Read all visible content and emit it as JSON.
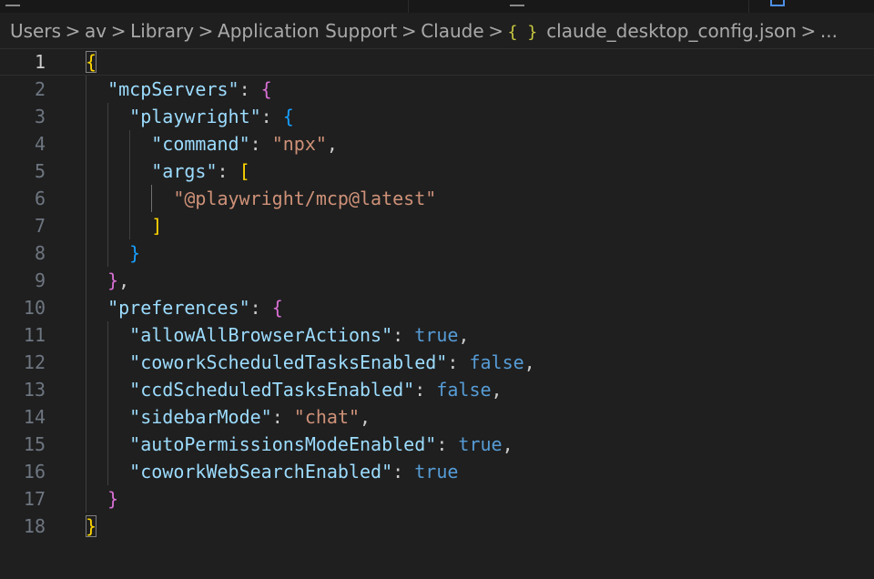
{
  "breadcrumb": [
    {
      "label": "Users"
    },
    {
      "label": "av"
    },
    {
      "label": "Library"
    },
    {
      "label": "Application Support"
    },
    {
      "label": "Claude"
    },
    {
      "label": "claude_desktop_config.json",
      "icon": "json-file-icon",
      "icon_glyph": "{ }"
    },
    {
      "label": "..."
    }
  ],
  "breadcrumb_separator": ">",
  "editor": {
    "current_line": 1,
    "syntax_colors": {
      "key": "#9cdcfe",
      "string": "#ce9178",
      "keyword": "#569cd6",
      "bracket_level_1": "#ffd700",
      "bracket_level_2": "#da70d6",
      "bracket_level_3": "#179fff"
    },
    "lines": [
      {
        "num": "1",
        "indent": 0,
        "tokens": [
          {
            "t": "{",
            "c": "b1"
          }
        ]
      },
      {
        "num": "2",
        "indent": 1,
        "tokens": [
          {
            "t": "\"mcpServers\"",
            "c": "key"
          },
          {
            "t": ": ",
            "c": "p"
          },
          {
            "t": "{",
            "c": "b2"
          }
        ]
      },
      {
        "num": "3",
        "indent": 2,
        "tokens": [
          {
            "t": "\"playwright\"",
            "c": "key"
          },
          {
            "t": ": ",
            "c": "p"
          },
          {
            "t": "{",
            "c": "b3"
          }
        ]
      },
      {
        "num": "4",
        "indent": 3,
        "tokens": [
          {
            "t": "\"command\"",
            "c": "key"
          },
          {
            "t": ": ",
            "c": "p"
          },
          {
            "t": "\"npx\"",
            "c": "str"
          },
          {
            "t": ",",
            "c": "p"
          }
        ]
      },
      {
        "num": "5",
        "indent": 3,
        "tokens": [
          {
            "t": "\"args\"",
            "c": "key"
          },
          {
            "t": ": ",
            "c": "p"
          },
          {
            "t": "[",
            "c": "b1"
          }
        ]
      },
      {
        "num": "6",
        "indent": 4,
        "tokens": [
          {
            "t": "\"@playwright/mcp@latest\"",
            "c": "str"
          }
        ]
      },
      {
        "num": "7",
        "indent": 3,
        "tokens": [
          {
            "t": "]",
            "c": "b1"
          }
        ]
      },
      {
        "num": "8",
        "indent": 2,
        "tokens": [
          {
            "t": "}",
            "c": "b3"
          }
        ]
      },
      {
        "num": "9",
        "indent": 1,
        "tokens": [
          {
            "t": "}",
            "c": "b2"
          },
          {
            "t": ",",
            "c": "p"
          }
        ]
      },
      {
        "num": "10",
        "indent": 1,
        "tokens": [
          {
            "t": "\"preferences\"",
            "c": "key"
          },
          {
            "t": ": ",
            "c": "p"
          },
          {
            "t": "{",
            "c": "b2"
          }
        ]
      },
      {
        "num": "11",
        "indent": 2,
        "tokens": [
          {
            "t": "\"allowAllBrowserActions\"",
            "c": "key"
          },
          {
            "t": ": ",
            "c": "p"
          },
          {
            "t": "true",
            "c": "kw"
          },
          {
            "t": ",",
            "c": "p"
          }
        ]
      },
      {
        "num": "12",
        "indent": 2,
        "tokens": [
          {
            "t": "\"coworkScheduledTasksEnabled\"",
            "c": "key"
          },
          {
            "t": ": ",
            "c": "p"
          },
          {
            "t": "false",
            "c": "kw"
          },
          {
            "t": ",",
            "c": "p"
          }
        ]
      },
      {
        "num": "13",
        "indent": 2,
        "tokens": [
          {
            "t": "\"ccdScheduledTasksEnabled\"",
            "c": "key"
          },
          {
            "t": ": ",
            "c": "p"
          },
          {
            "t": "false",
            "c": "kw"
          },
          {
            "t": ",",
            "c": "p"
          }
        ]
      },
      {
        "num": "14",
        "indent": 2,
        "tokens": [
          {
            "t": "\"sidebarMode\"",
            "c": "key"
          },
          {
            "t": ": ",
            "c": "p"
          },
          {
            "t": "\"chat\"",
            "c": "str"
          },
          {
            "t": ",",
            "c": "p"
          }
        ]
      },
      {
        "num": "15",
        "indent": 2,
        "tokens": [
          {
            "t": "\"autoPermissionsModeEnabled\"",
            "c": "key"
          },
          {
            "t": ": ",
            "c": "p"
          },
          {
            "t": "true",
            "c": "kw"
          },
          {
            "t": ",",
            "c": "p"
          }
        ]
      },
      {
        "num": "16",
        "indent": 2,
        "tokens": [
          {
            "t": "\"coworkWebSearchEnabled\"",
            "c": "key"
          },
          {
            "t": ": ",
            "c": "p"
          },
          {
            "t": "true",
            "c": "kw"
          }
        ]
      },
      {
        "num": "17",
        "indent": 1,
        "tokens": [
          {
            "t": "}",
            "c": "b2"
          }
        ]
      },
      {
        "num": "18",
        "indent": 0,
        "tokens": [
          {
            "t": "}",
            "c": "b1"
          }
        ]
      }
    ]
  }
}
